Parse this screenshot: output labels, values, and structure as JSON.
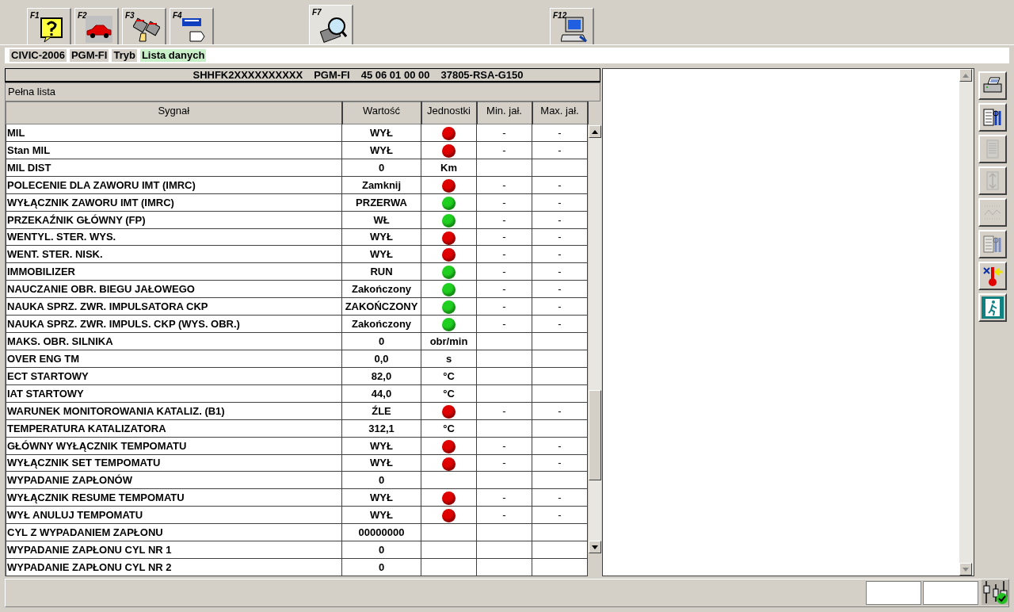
{
  "function_tabs": [
    {
      "key": "F1",
      "selected": false
    },
    {
      "key": "F2",
      "selected": false
    },
    {
      "key": "F3",
      "selected": false
    },
    {
      "key": "F4",
      "selected": false
    },
    {
      "key": "F7",
      "selected": true
    },
    {
      "key": "F12",
      "selected": false
    }
  ],
  "breadcrumb": [
    {
      "label": "CIVIC-2006",
      "selected": false
    },
    {
      "label": "PGM-FI",
      "selected": false
    },
    {
      "label": "Tryb",
      "selected": false
    },
    {
      "label": "Lista danych",
      "selected": true
    }
  ],
  "ecu_info": [
    "SHHFK2XXXXXXXXXX",
    "PGM-FI",
    "45 06 01 00 00",
    "37805-RSA-G150"
  ],
  "list_title": "Pełna lista",
  "table": {
    "columns": [
      "Sygnał",
      "Wartość",
      "Jednostki",
      "Min. jał.",
      "Max. jał."
    ],
    "rows": [
      {
        "signal": "MIL",
        "value": "WYŁ",
        "lamp": {
          "color": "#e00000"
        },
        "min": "-",
        "max": "-"
      },
      {
        "signal": "Stan MIL",
        "value": "WYŁ",
        "lamp": {
          "color": "#e00000"
        },
        "min": "-",
        "max": "-"
      },
      {
        "signal": "MIL DIST",
        "value": "0",
        "unit": "Km"
      },
      {
        "signal": "POLECENIE DLA ZAWORU IMT (IMRC)",
        "value": "Zamknij",
        "lamp": {
          "color": "#e00000"
        },
        "min": "-",
        "max": "-"
      },
      {
        "signal": "WYŁĄCZNIK ZAWORU IMT (IMRC)",
        "value": "PRZERWA",
        "lamp": {
          "color": "#20d020"
        },
        "min": "-",
        "max": "-"
      },
      {
        "signal": "PRZEKAŹNIK GŁÓWNY (FP)",
        "value": "WŁ",
        "lamp": {
          "color": "#20d020"
        },
        "min": "-",
        "max": "-"
      },
      {
        "signal": "WENTYL. STER. WYS.",
        "value": "WYŁ",
        "lamp": {
          "color": "#e00000"
        },
        "min": "-",
        "max": "-"
      },
      {
        "signal": "WENT. STER. NISK.",
        "value": "WYŁ",
        "lamp": {
          "color": "#e00000"
        },
        "min": "-",
        "max": "-"
      },
      {
        "signal": "IMMOBILIZER",
        "value": "RUN",
        "lamp": {
          "color": "#20d020"
        },
        "min": "-",
        "max": "-"
      },
      {
        "signal": "NAUCZANIE OBR. BIEGU JAŁOWEGO",
        "value": "Zakończony",
        "lamp": {
          "color": "#20d020"
        },
        "min": "-",
        "max": "-"
      },
      {
        "signal": "NAUKA SPRZ. ZWR. IMPULSATORA CKP",
        "value": "ZAKOŃCZONY",
        "lamp": {
          "color": "#20d020"
        },
        "min": "-",
        "max": "-"
      },
      {
        "signal": "NAUKA SPRZ. ZWR. IMPULS. CKP (WYS. OBR.)",
        "value": "Zakończony",
        "lamp": {
          "color": "#20d020"
        },
        "min": "-",
        "max": "-"
      },
      {
        "signal": "MAKS. OBR. SILNIKA",
        "value": "0",
        "unit": "obr/min"
      },
      {
        "signal": "OVER ENG TM",
        "value": "0,0",
        "unit": "s"
      },
      {
        "signal": "ECT STARTOWY",
        "value": "82,0",
        "unit": "°C"
      },
      {
        "signal": "IAT STARTOWY",
        "value": "44,0",
        "unit": "°C"
      },
      {
        "signal": "WARUNEK MONITOROWANIA KATALIZ. (B1)",
        "value": "ŹLE",
        "lamp": {
          "color": "#e00000"
        },
        "min": "-",
        "max": "-"
      },
      {
        "signal": "TEMPERATURA KATALIZATORA",
        "value": "312,1",
        "unit": "°C"
      },
      {
        "signal": "GŁÓWNY WYŁĄCZNIK TEMPOMATU",
        "value": "WYŁ",
        "lamp": {
          "color": "#e00000"
        },
        "min": "-",
        "max": "-"
      },
      {
        "signal": "WYŁĄCZNIK SET TEMPOMATU",
        "value": "WYŁ",
        "lamp": {
          "color": "#e00000"
        },
        "min": "-",
        "max": "-"
      },
      {
        "signal": "WYPADANIE ZAPŁONÓW",
        "value": "0"
      },
      {
        "signal": "WYŁĄCZNIK RESUME TEMPOMATU",
        "value": "WYŁ",
        "lamp": {
          "color": "#e00000"
        },
        "min": "-",
        "max": "-"
      },
      {
        "signal": "WYŁ ANULUJ TEMPOMATU",
        "value": "WYŁ",
        "lamp": {
          "color": "#e00000"
        },
        "min": "-",
        "max": "-"
      },
      {
        "signal": "CYL Z WYPADANIEM ZAPŁONU",
        "value": "00000000"
      },
      {
        "signal": "WYPADANIE ZAPŁONU CYL NR 1",
        "value": "0"
      },
      {
        "signal": "WYPADANIE ZAPŁONU CYL NR 2",
        "value": "0"
      }
    ]
  },
  "side_tools": [
    {
      "disabled": false
    },
    {
      "disabled": false
    },
    {
      "disabled": true
    },
    {
      "disabled": true
    },
    {
      "disabled": true
    },
    {
      "disabled": true
    },
    {
      "disabled": false
    },
    {
      "disabled": false
    }
  ]
}
